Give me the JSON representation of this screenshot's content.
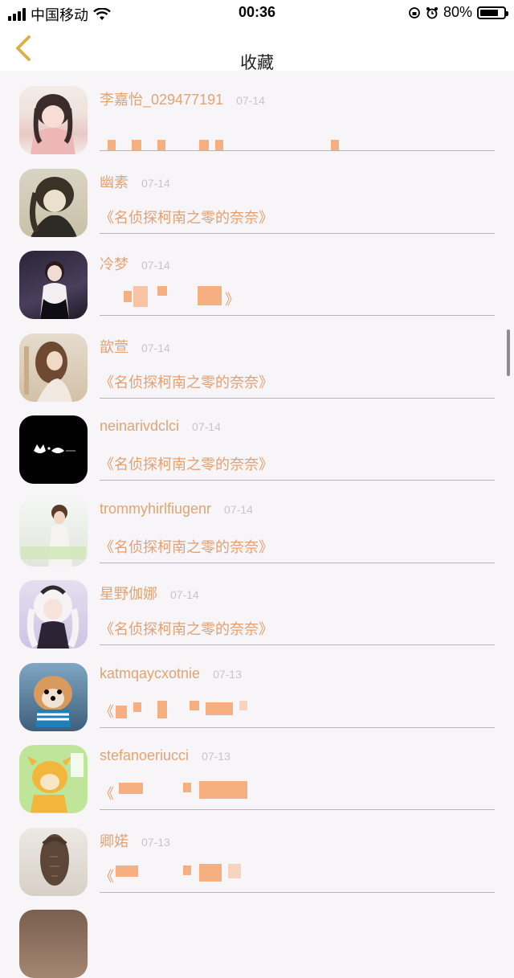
{
  "status_bar": {
    "carrier": "中国移动",
    "time": "00:36",
    "battery": "80%",
    "battery_level": 0.8
  },
  "nav": {
    "title": "收藏"
  },
  "items": [
    {
      "name": "李嘉怡_029477191",
      "time": "07-14",
      "work": ""
    },
    {
      "name": "幽素",
      "time": "07-14",
      "work": "《名侦探柯南之零的奈奈》"
    },
    {
      "name": "冷梦",
      "time": "07-14",
      "work": "》"
    },
    {
      "name": "歆萱",
      "time": "07-14",
      "work": "《名侦探柯南之零的奈奈》"
    },
    {
      "name": "neinarivdclci",
      "time": "07-14",
      "work": "《名侦探柯南之零的奈奈》"
    },
    {
      "name": "trommyhirlfiugenr",
      "time": "07-14",
      "work": "《名侦探柯南之零的奈奈》"
    },
    {
      "name": "星野伽娜",
      "time": "07-14",
      "work": "《名侦探柯南之零的奈奈》"
    },
    {
      "name": "katmqaycxotnie",
      "time": "07-13",
      "work": "《"
    },
    {
      "name": "stefanoeriucci",
      "time": "07-13",
      "work": "《"
    },
    {
      "name": "卿婼",
      "time": "07-13",
      "work": "《"
    }
  ],
  "colors": {
    "name": "#e0a476",
    "work": "#e5a070",
    "time": "#c9c4c8",
    "background": "#f7f5f8"
  },
  "icons": [
    "signal-icon",
    "wifi-icon",
    "lock-rotation-icon",
    "alarm-icon",
    "battery-icon",
    "back-chevron-icon"
  ]
}
